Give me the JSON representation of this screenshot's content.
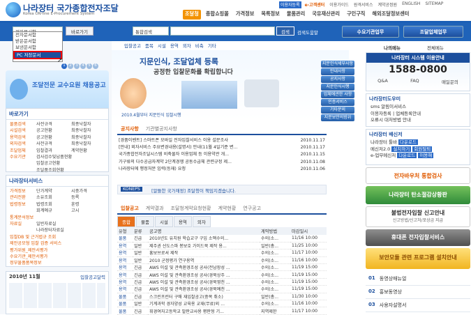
{
  "header": {
    "logo_title": "나라장터 국가종합전자조달",
    "logo_sub": "Korea ON-line E-Procurement System",
    "util_links": [
      "이용자등록",
      "e-고객센터",
      "이용가이드",
      "원격서비스",
      "계약공정원",
      "ENGLISH",
      "SITEMAP"
    ],
    "main_nav": [
      "조달청",
      "종합쇼핑몰",
      "가격정보",
      "목록정보",
      "물품관리",
      "국유재산관리",
      "구인구직",
      "해외조달정보센터"
    ]
  },
  "search": {
    "select1": "전자문서함",
    "go_button": "바로가기",
    "select2": "통합검색",
    "search_button": "검색",
    "help_link": "검색도움말",
    "btn_demand": "수요기관업무",
    "btn_supplier": "조달업체업무"
  },
  "dropdown": {
    "items": [
      "전자문서함",
      "받은문서함",
      "보낸문서함",
      "PC 저장문서"
    ],
    "highlighted": "PC 저장문서"
  },
  "left": {
    "page_nums": [
      "1",
      "2",
      "3",
      "4",
      "5",
      "6"
    ],
    "promo_text": "조달전문 교수요원 채용공고",
    "shortcut_title": "바로가기",
    "shortcuts": [
      [
        "물품검색",
        "사전규격",
        "최종낙찰자"
      ],
      [
        "시설검색",
        "공고현황",
        "최종낙찰자"
      ],
      [
        "용역검색",
        "공고현황",
        "최종낙찰자"
      ],
      [
        "외자검색",
        "사전규격",
        "최종낙찰자"
      ],
      [
        "조달업체",
        "입찰결과",
        "계약현황"
      ],
      [
        "수요기관",
        "검사검수및납품현황",
        ""
      ],
      [
        "",
        "입찰공고현황",
        ""
      ],
      [
        "",
        "조달품조회현황",
        ""
      ]
    ],
    "service_title": "나라장터서비스",
    "services": [
      [
        "가격정보",
        "단가계약",
        "시중가격"
      ],
      [
        "관리전환",
        "소유조회",
        "등록"
      ],
      [
        "법령정보",
        "법령조회",
        "훈령"
      ],
      [
        "",
        "회계예규",
        "고시"
      ],
      [
        "통계분석정보",
        "",
        ""
      ],
      [
        "자료실",
        "일반자료실",
        ""
      ],
      [
        "",
        "나라장터자료실",
        ""
      ],
      [
        "입찰DB 및 근거법규 조회",
        "",
        ""
      ],
      [
        "제안공모형 입찰 검증 서비스",
        "",
        ""
      ],
      [
        "평가위원_제안서평가",
        "",
        ""
      ],
      [
        "수요기관_제안서평가",
        "",
        ""
      ],
      [
        "정부물품품목정보",
        "",
        ""
      ]
    ],
    "calendar_title": "2010년 11월",
    "calendar_sub": "입찰공고달력"
  },
  "center": {
    "tabs": [
      "입찰공고",
      "품목",
      "시설",
      "용역",
      "외자",
      "비축",
      "기타"
    ],
    "banner_line1": "지문인식, 조달업체 등록",
    "banner_line2": "공정한 입찰문화를 확립합니다",
    "banner_date": "2010.4월부터 지문인식 입찰시행",
    "banner_menu": [
      "지문인식세부사항",
      "안내사항",
      "공지사항",
      "지문인식시행",
      "업체에관한 사항",
      "인증서비스",
      "기타문의",
      "지문보안의범위"
    ],
    "notice_tabs": [
      "공지사항",
      "기관별공지사항"
    ],
    "notices": [
      {
        "t": "[경품이벤트] 스마트폰 모바일 전자입찰서비스 이용 설문조사",
        "d": "2010.11.17"
      },
      {
        "t": "[안내] 외자서비스 주요변경내용(설명서) 안내(11월 4일기준 변...",
        "d": "2010.11.17"
      },
      {
        "t": "국가종합전자조달시스템 비축물자 이용업체 등 이용약관 개...",
        "d": "2010.11.15"
      },
      {
        "t": "가구류의 다수공급자계약 2단계경쟁 공동수급체 관련규정 제...",
        "d": "2010.11.08"
      },
      {
        "t": "나라장터에 행정처분 입력(등재) 요청",
        "d": "2010.11.06"
      }
    ],
    "koneps_label": "KONEPS",
    "koneps_text": "[알뜰한 국가재정] 조달청이 책임지겠습니다.",
    "bid_tabs": [
      "입찰공고",
      "계약결과",
      "조달청계약요청현황",
      "계약현황",
      "연구공고"
    ],
    "bid_subtabs": [
      "종합",
      "물품",
      "시설",
      "용역",
      "외자"
    ],
    "bid_headers": [
      "유형",
      "분류",
      "공고명",
      "계약방법",
      "마감일시"
    ],
    "bids": [
      [
        "물품",
        "긴급",
        "2010년도 유치원 학습교구 구입 소액수의...",
        "수의(소...",
        "11/16 10:00"
      ],
      [
        "용역",
        "일반",
        "제주권 선도스파 봉보호 가이드북 제작 용...",
        "일반(총...",
        "11/25 10:00"
      ],
      [
        "용역",
        "일반",
        "홍보브로셔 제작",
        "수의(소...",
        "11/17 10:00"
      ],
      [
        "용역",
        "일반",
        "2010 군정평가 연구용역",
        "수의(소...",
        "11/16 10:00"
      ],
      [
        "용역",
        "긴급",
        "AWS 이설 및 관측환경조성 공사(전남장성 ...",
        "수의(소...",
        "11/19 15:00"
      ],
      [
        "용역",
        "긴급",
        "AWS 이설 및 관측환경조성 공사(경북상주 ...",
        "수의(소...",
        "11/19 15:00"
      ],
      [
        "용역",
        "긴급",
        "AWS 이설 및 관측환경조성 공사(경북영천 ...",
        "수의(소...",
        "11/19 15:00"
      ],
      [
        "용역",
        "긴급",
        "AWS 이설 및 관측환경조성 공사(경북예천 ...",
        "수의(소...",
        "11/19 15:00"
      ],
      [
        "물품",
        "긴급",
        "스크린프린터 구매 재입찰공고(중복 취소)",
        "일반(총...",
        "11/30 10:00"
      ],
      [
        "물품",
        "일반",
        "기계과학 경자양성 교육용 교재(무료)외 ...",
        "수의(소...",
        "11/16 10:00"
      ],
      [
        "물품",
        "긴급",
        "휘경여자고등학교 발판교사용 평판형 기...",
        "지역제한",
        "11/17 10:00"
      ]
    ]
  },
  "right": {
    "menu_label": "나의메뉴",
    "menu_all": "전체메뉴",
    "callcenter_title": "나라장터 시스템 이용안내",
    "phone": "1588-0800",
    "cc_links": [
      "Q&A",
      "FAQ",
      "매일문의"
    ],
    "news_title": "나라장터도우미",
    "news_items": [
      "sms 알림이서비스",
      "이용자등록 | 업체등록안내",
      "오류시 대처방법 안내"
    ],
    "center_title": "나라장터 배신저",
    "center_items": [
      "나라장터 툴바",
      "다운로드",
      "메신저2.0",
      "설치하기",
      "회원탈퇴",
      "e-업무메신저",
      "다운로드",
      "이용해"
    ],
    "promos": [
      "전자바우처 통합검사",
      "나라장터 탄소절감상황판",
      "불법전자입찰 신고안내",
      "휴대폰 전자입찰서비스",
      "보안모듈 관련 프로그램 설치안내"
    ],
    "promo_sub": "신고방법/신고처/포상금 지급",
    "bottom_items": [
      {
        "n": "01",
        "t": "동영상매뉴얼"
      },
      {
        "n": "02",
        "t": "홍보동영상"
      },
      {
        "n": "03",
        "t": "사용자설명서"
      }
    ]
  }
}
